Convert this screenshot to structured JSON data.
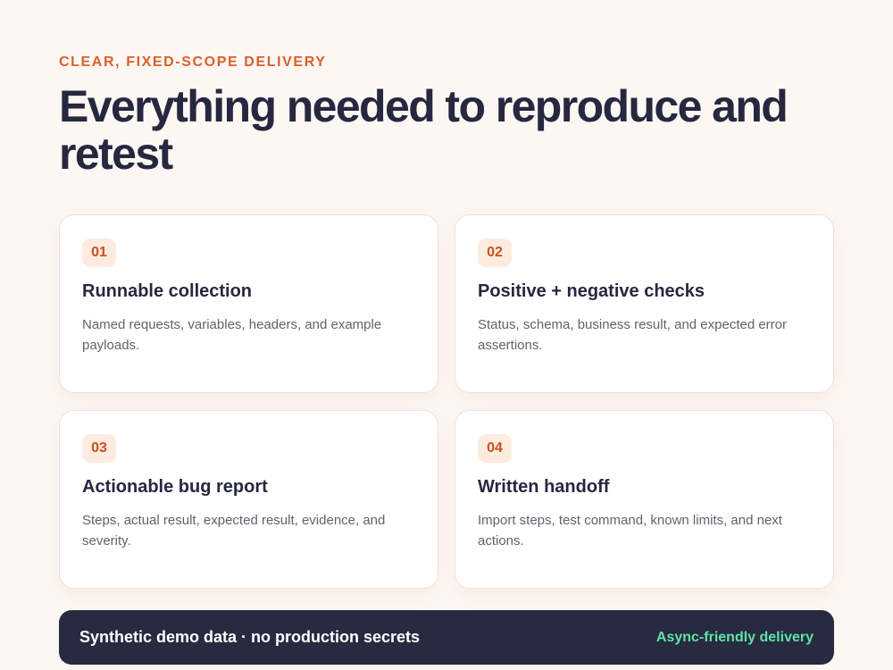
{
  "header": {
    "eyebrow": "CLEAR, FIXED-SCOPE DELIVERY",
    "title": "Everything needed to reproduce and retest"
  },
  "cards": [
    {
      "number": "01",
      "title": "Runnable collection",
      "description": "Named requests, variables, headers, and example payloads."
    },
    {
      "number": "02",
      "title": "Positive + negative checks",
      "description": "Status, schema, business result, and expected error assertions."
    },
    {
      "number": "03",
      "title": "Actionable bug report",
      "description": "Steps, actual result, expected result, evidence, and severity."
    },
    {
      "number": "04",
      "title": "Written handoff",
      "description": "Import steps, test command, known limits, and next actions."
    }
  ],
  "footer": {
    "note": "Synthetic demo data · no production secrets",
    "tag": "Async-friendly delivery"
  },
  "colors": {
    "background": "#fdf7f3",
    "accent": "#d9602c",
    "heading": "#262840",
    "footer_bg": "#272a40",
    "footer_tag": "#5fe3a6"
  }
}
